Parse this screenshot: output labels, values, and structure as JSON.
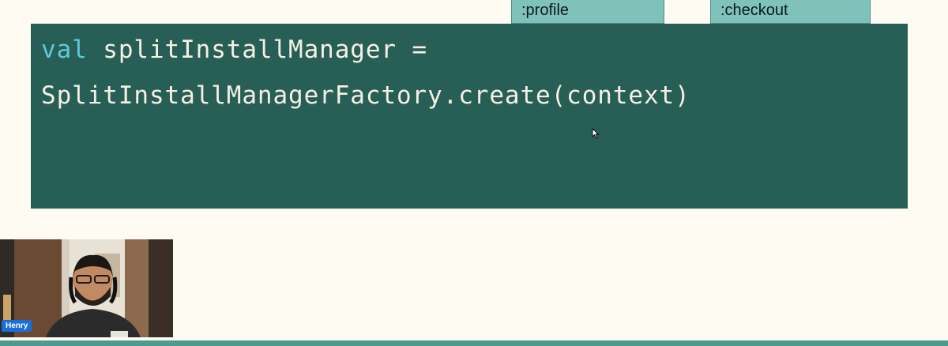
{
  "slide": {
    "modules": {
      "profile_label": ":profile",
      "checkout_label": ":checkout"
    },
    "code": {
      "line1_keyword": "val",
      "line1_rest": " splitInstallManager =",
      "line2": "SplitInstallManagerFactory.create(context)"
    }
  },
  "webcam": {
    "participant_name": "Henry"
  },
  "colors": {
    "background": "#fdfbf2",
    "code_panel": "#275e56",
    "keyword": "#5fc9d8",
    "module_box": "#7fc2ba",
    "name_tag": "#1a6fd6",
    "bottom_bar": "#4f9a8f"
  },
  "icons": {
    "mouse_pointer": "cursor-icon"
  }
}
